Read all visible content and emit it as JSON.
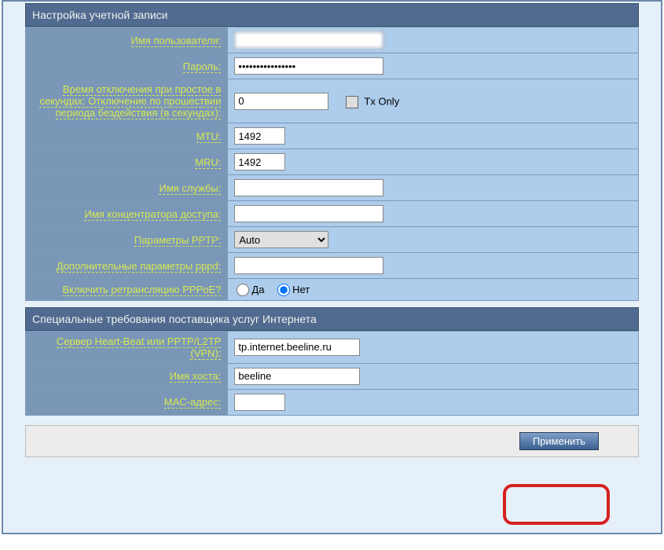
{
  "section1": {
    "title": "Настройка учетной записи",
    "rows": {
      "username_label": "Имя пользователя:",
      "username_value": "",
      "password_label": "Пароль:",
      "password_value": "••••••••••••••••",
      "idle_label": "Время отключения при простое в секундах: Отключение по прошествии периода бездействия (в секундах):",
      "idle_value": "0",
      "txonly_label": "Tx Only",
      "mtu_label": "MTU:",
      "mtu_value": "1492",
      "mru_label": "MRU:",
      "mru_value": "1492",
      "service_label": "Имя службы:",
      "service_value": "",
      "concentrator_label": "Имя концентратора доступа:",
      "concentrator_value": "",
      "pptp_label": "Параметры PPTP:",
      "pptp_value": "Auto",
      "pppd_label": "Дополнительные параметры pppd:",
      "pppd_value": "",
      "relay_label": "Включить ретрансляцию PPPoE?",
      "relay_yes": "Да",
      "relay_no": "Нет"
    }
  },
  "section2": {
    "title": "Специальные требования поставщика услуг Интернета",
    "rows": {
      "heartbeat_label": "Сервер Heart-Beat или PPTP/L2TP (VPN):",
      "heartbeat_value": "tp.internet.beeline.ru",
      "hostname_label": "Имя хоста:",
      "hostname_value": "beeline",
      "mac_label": "MAC-адрес:",
      "mac_value": ""
    }
  },
  "footer": {
    "apply_label": "Применить"
  }
}
